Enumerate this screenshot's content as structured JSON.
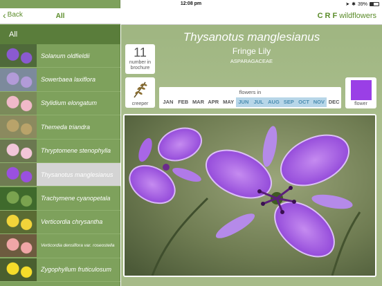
{
  "status": {
    "device": "iPad",
    "time": "12:08 pm",
    "battery": "39%",
    "battery_level": 0.39
  },
  "left_nav": {
    "back_label": "Back",
    "title": "All"
  },
  "list_header": "All",
  "list": [
    {
      "label": "Solanum oldfieldii",
      "thumb": "purple-star-flowers",
      "selected": false
    },
    {
      "label": "Sowerbaea laxiflora",
      "thumb": "lilac-flower-clusters",
      "selected": false
    },
    {
      "label": "Stylidium elongatum",
      "thumb": "pink-trigger-plant",
      "selected": false
    },
    {
      "label": "Themeda triandra",
      "thumb": "grass-seed-heads",
      "selected": false
    },
    {
      "label": "Thryptomene stenophylla",
      "thumb": "pink-white-shrub",
      "selected": false
    },
    {
      "label": "Thysanotus manglesianus",
      "thumb": "fringe-lily",
      "selected": true
    },
    {
      "label": "Trachymene cyanopetala",
      "thumb": "green-leaves",
      "selected": false
    },
    {
      "label": "Verticordia chrysantha",
      "thumb": "yellow-feather-flowers",
      "selected": false
    },
    {
      "label": "Verticordia densiflora var. roseostella",
      "thumb": "pink-feather-flowers",
      "selected": false
    },
    {
      "label": "Zygophyllum fruticulosum",
      "thumb": "yellow-flower",
      "selected": false
    }
  ],
  "logo": {
    "initials": "CRF",
    "word": "wildflowers"
  },
  "plant": {
    "scientific_name": "Thysanotus manglesianus",
    "common_name": "Fringe Lily",
    "family": "ASPARAGACEAE",
    "brochure_number": "11",
    "brochure_label": "number in brochure",
    "habit_label": "creeper",
    "habit_icon": "creeper-icon",
    "flowering_title": "flowers in",
    "months": [
      {
        "label": "JAN",
        "on": false
      },
      {
        "label": "FEB",
        "on": false
      },
      {
        "label": "MAR",
        "on": false
      },
      {
        "label": "APR",
        "on": false
      },
      {
        "label": "MAY",
        "on": false
      },
      {
        "label": "JUN",
        "on": true
      },
      {
        "label": "JUL",
        "on": true
      },
      {
        "label": "AUG",
        "on": true
      },
      {
        "label": "SEP",
        "on": true
      },
      {
        "label": "OCT",
        "on": true
      },
      {
        "label": "NOV",
        "on": true
      },
      {
        "label": "DEC",
        "on": false
      }
    ],
    "flower_color": "#9a3fe6",
    "flower_color_label": "flower"
  },
  "colors": {
    "accent": "#5b8c2a",
    "panel_green": "#7ea15c",
    "month_highlight": "#b7d6e8"
  }
}
